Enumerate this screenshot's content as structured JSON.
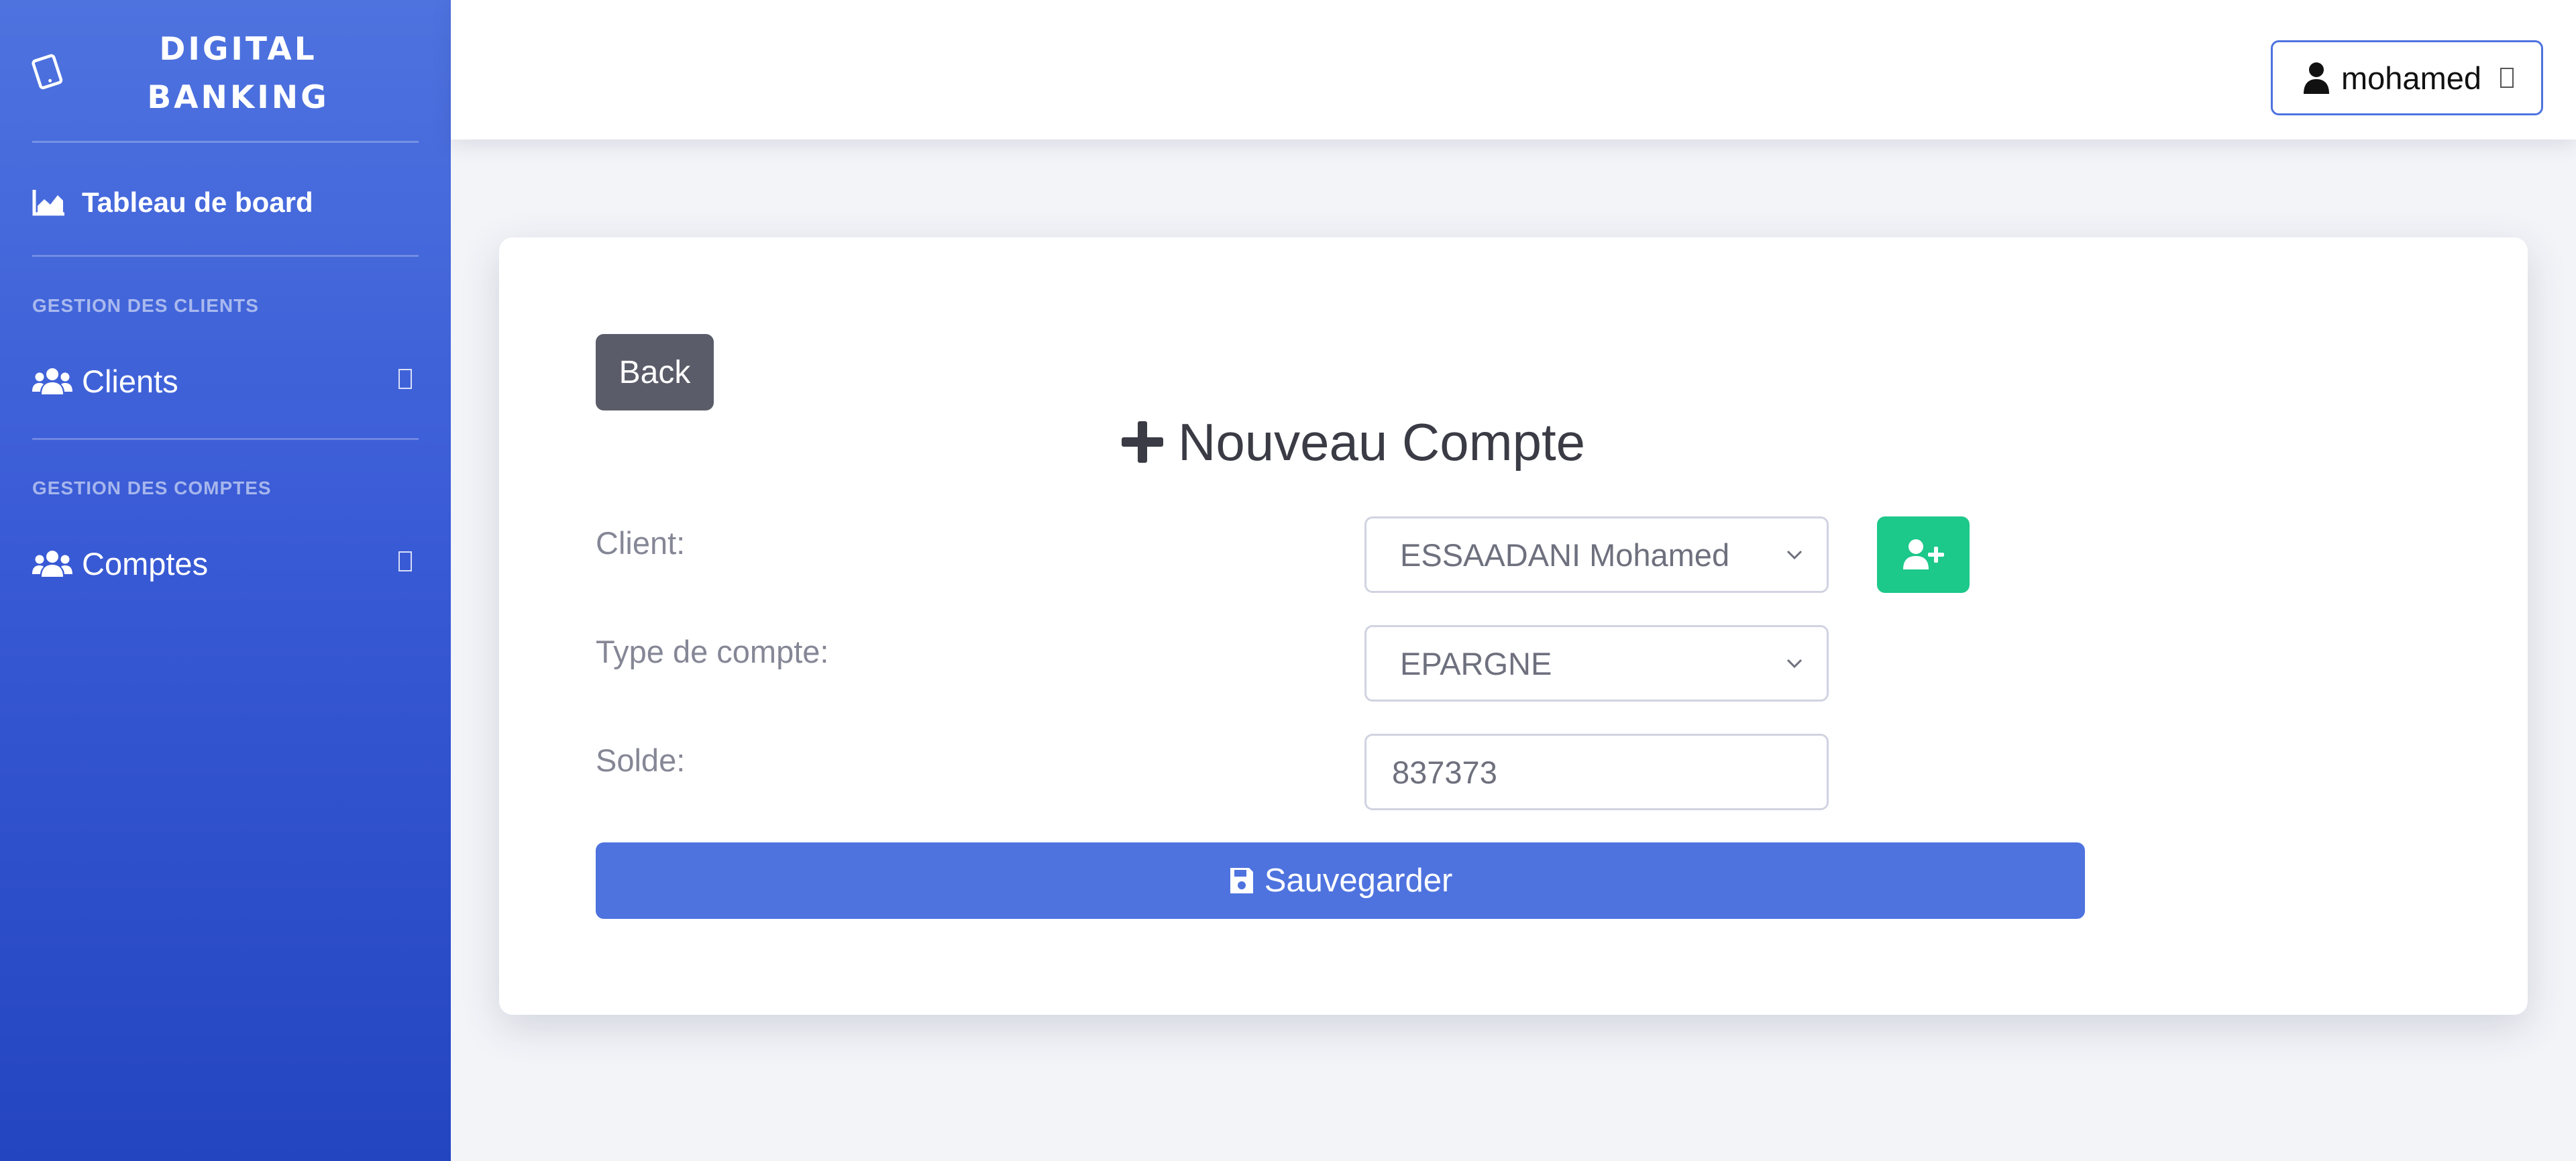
{
  "brand": {
    "title": "DIGITAL BANKING",
    "icon": "tablet-icon"
  },
  "sidebar": {
    "dashboard": {
      "label": "Tableau de board",
      "icon": "chart-area-icon"
    },
    "sections": [
      {
        "heading": "GESTION DES CLIENTS",
        "item": {
          "label": "Clients",
          "icon": "users-icon"
        }
      },
      {
        "heading": "GESTION DES COMPTES",
        "item": {
          "label": "Comptes",
          "icon": "users-icon"
        }
      }
    ]
  },
  "topbar": {
    "user": {
      "name": "mohamed",
      "icon": "user-icon"
    }
  },
  "form": {
    "back_label": "Back",
    "title": "Nouveau Compte",
    "title_icon": "plus-icon",
    "client": {
      "label": "Client:",
      "value": "ESSAADANI Mohamed"
    },
    "account_type": {
      "label": "Type de compte:",
      "value": "EPARGNE"
    },
    "balance": {
      "label": "Solde:",
      "value": "837373"
    },
    "add_client_icon": "user-plus-icon",
    "save_label": "Sauvegarder",
    "save_icon": "floppy-disk-icon"
  },
  "colors": {
    "primary": "#4e73df",
    "success": "#1cc88a",
    "secondary": "#5a5c69",
    "sidebar_bottom": "#2445c0"
  }
}
